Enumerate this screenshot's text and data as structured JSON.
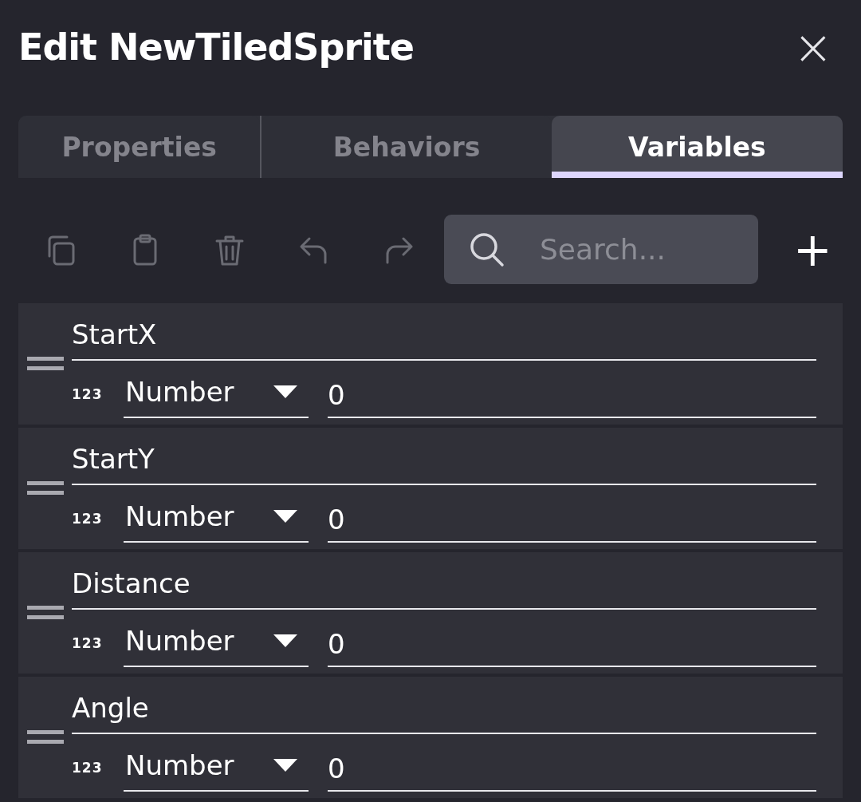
{
  "dialog": {
    "title": "Edit NewTiledSprite",
    "close_label": "×"
  },
  "tabs": [
    {
      "label": "Properties",
      "selected": false
    },
    {
      "label": "Behaviors",
      "selected": false
    },
    {
      "label": "Variables",
      "selected": true
    }
  ],
  "toolbar": {
    "buttons": [
      {
        "kind": "copy",
        "disabled": true
      },
      {
        "kind": "paste",
        "disabled": true
      },
      {
        "kind": "delete",
        "disabled": true
      },
      {
        "kind": "undo",
        "disabled": true
      },
      {
        "kind": "redo",
        "disabled": true
      }
    ],
    "search": {
      "placeholder": "Search..."
    },
    "add_label": "+"
  },
  "variables": [
    {
      "name": "StartX",
      "type_icon": "123",
      "type": "Number",
      "value": "0"
    },
    {
      "name": "StartY",
      "type_icon": "123",
      "type": "Number",
      "value": "0"
    },
    {
      "name": "Distance",
      "type_icon": "123",
      "type": "Number",
      "value": "0"
    },
    {
      "name": "Angle",
      "type_icon": "123",
      "type": "Number",
      "value": "0"
    }
  ]
}
